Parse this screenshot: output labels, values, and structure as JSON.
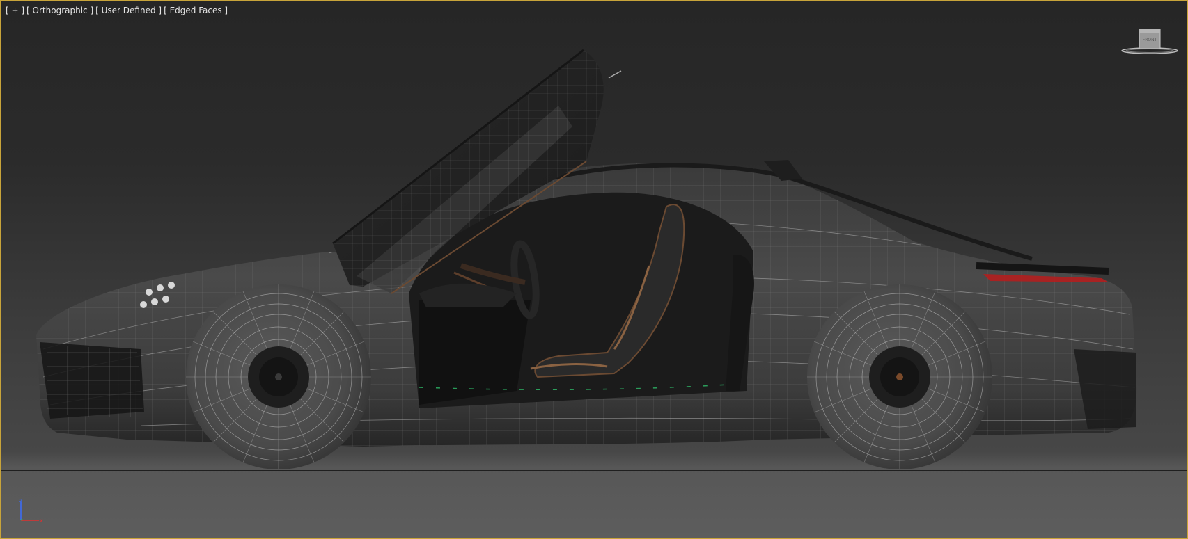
{
  "viewport": {
    "labels": [
      "[ + ]",
      "[ Orthographic ]",
      "[ User Defined ]",
      "[ Edged Faces ]"
    ],
    "viewcube_face": "FRONT",
    "axis_labels": {
      "z": "z",
      "x": "x"
    },
    "colors": {
      "active_border": "#c8a43a",
      "background_top": "#262626",
      "background_bottom": "#5d5d5d",
      "wire": "#a8a8a8",
      "axis_x": "#e03030",
      "axis_z": "#3a6cff",
      "axis_y": "#30c030"
    }
  }
}
